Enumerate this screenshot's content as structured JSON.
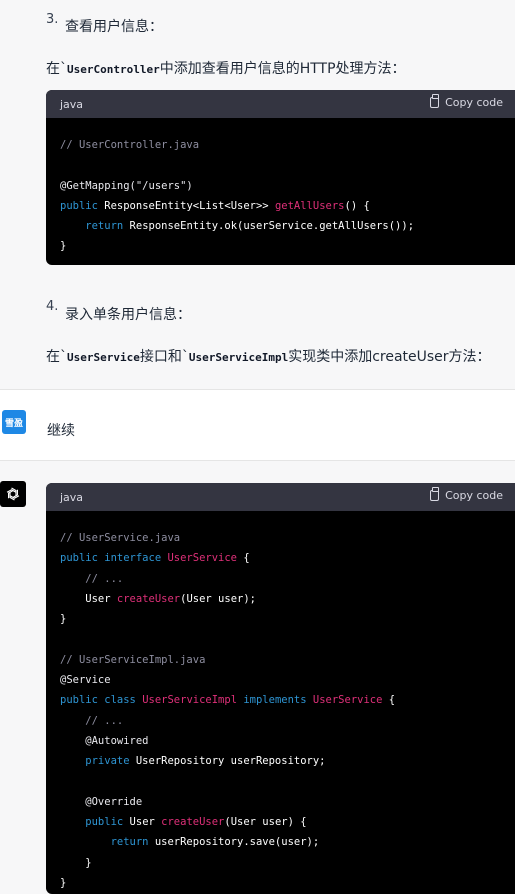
{
  "step3": {
    "number": "3.",
    "title": "查看用户信息：",
    "para_prefix": "在`",
    "para_code": "UserController",
    "para_suffix": "中添加查看用户信息的HTTP处理方法："
  },
  "code1": {
    "lang": "java",
    "copy_label": "Copy code",
    "lines": [
      [
        {
          "t": "// UserController.java",
          "c": "comment"
        }
      ],
      [],
      [
        {
          "t": "@GetMapping(\"/users\")",
          "c": "ann"
        }
      ],
      [
        {
          "t": "public ",
          "c": "kw"
        },
        {
          "t": "ResponseEntity<List<User>> ",
          "c": "plain"
        },
        {
          "t": "getAllUsers",
          "c": "fn"
        },
        {
          "t": "() {",
          "c": "plain"
        }
      ],
      [
        {
          "t": "    return ",
          "c": "kw"
        },
        {
          "t": "ResponseEntity.ok(userService.getAllUsers());",
          "c": "plain"
        }
      ],
      [
        {
          "t": "}",
          "c": "plain"
        }
      ]
    ]
  },
  "step4": {
    "number": "4.",
    "title": "录入单条用户信息：",
    "para_prefix": "在`",
    "para_code1": "UserService",
    "para_mid": "接口和`",
    "para_code2": "UserServiceImpl",
    "para_suffix": "实现类中添加createUser方法："
  },
  "user_message": {
    "avatar_text": "雪盈",
    "text": "继续"
  },
  "assistant_avatar_icon": "openai-logo-icon",
  "code2": {
    "lang": "java",
    "copy_label": "Copy code",
    "lines": [
      [
        {
          "t": "// UserService.java",
          "c": "comment"
        }
      ],
      [
        {
          "t": "public interface ",
          "c": "kw"
        },
        {
          "t": "UserService",
          "c": "fn"
        },
        {
          "t": " {",
          "c": "plain"
        }
      ],
      [
        {
          "t": "    // ...",
          "c": "comment"
        }
      ],
      [
        {
          "t": "    User ",
          "c": "plain"
        },
        {
          "t": "createUser",
          "c": "fn"
        },
        {
          "t": "(User user);",
          "c": "plain"
        }
      ],
      [
        {
          "t": "}",
          "c": "plain"
        }
      ],
      [],
      [
        {
          "t": "// UserServiceImpl.java",
          "c": "comment"
        }
      ],
      [
        {
          "t": "@Service",
          "c": "ann"
        }
      ],
      [
        {
          "t": "public class ",
          "c": "kw"
        },
        {
          "t": "UserServiceImpl ",
          "c": "fn"
        },
        {
          "t": "implements ",
          "c": "kw"
        },
        {
          "t": "UserService",
          "c": "fn"
        },
        {
          "t": " {",
          "c": "plain"
        }
      ],
      [
        {
          "t": "    // ...",
          "c": "comment"
        }
      ],
      [
        {
          "t": "    @Autowired",
          "c": "ann"
        }
      ],
      [
        {
          "t": "    private ",
          "c": "kw"
        },
        {
          "t": "UserRepository userRepository;",
          "c": "plain"
        }
      ],
      [],
      [
        {
          "t": "    @Override",
          "c": "ann"
        }
      ],
      [
        {
          "t": "    public ",
          "c": "kw"
        },
        {
          "t": "User ",
          "c": "plain"
        },
        {
          "t": "createUser",
          "c": "fn"
        },
        {
          "t": "(User user) {",
          "c": "plain"
        }
      ],
      [
        {
          "t": "        return ",
          "c": "kw"
        },
        {
          "t": "userRepository.save(user);",
          "c": "plain"
        }
      ],
      [
        {
          "t": "    }",
          "c": "plain"
        }
      ],
      [
        {
          "t": "}",
          "c": "plain"
        }
      ]
    ]
  },
  "colors": {
    "code_bg": "#000000",
    "code_header_bg": "#343541",
    "keyword": "#2e95d3",
    "function": "#df3079",
    "comment": "#8e8ea0",
    "user_avatar": "#1e88e5"
  }
}
